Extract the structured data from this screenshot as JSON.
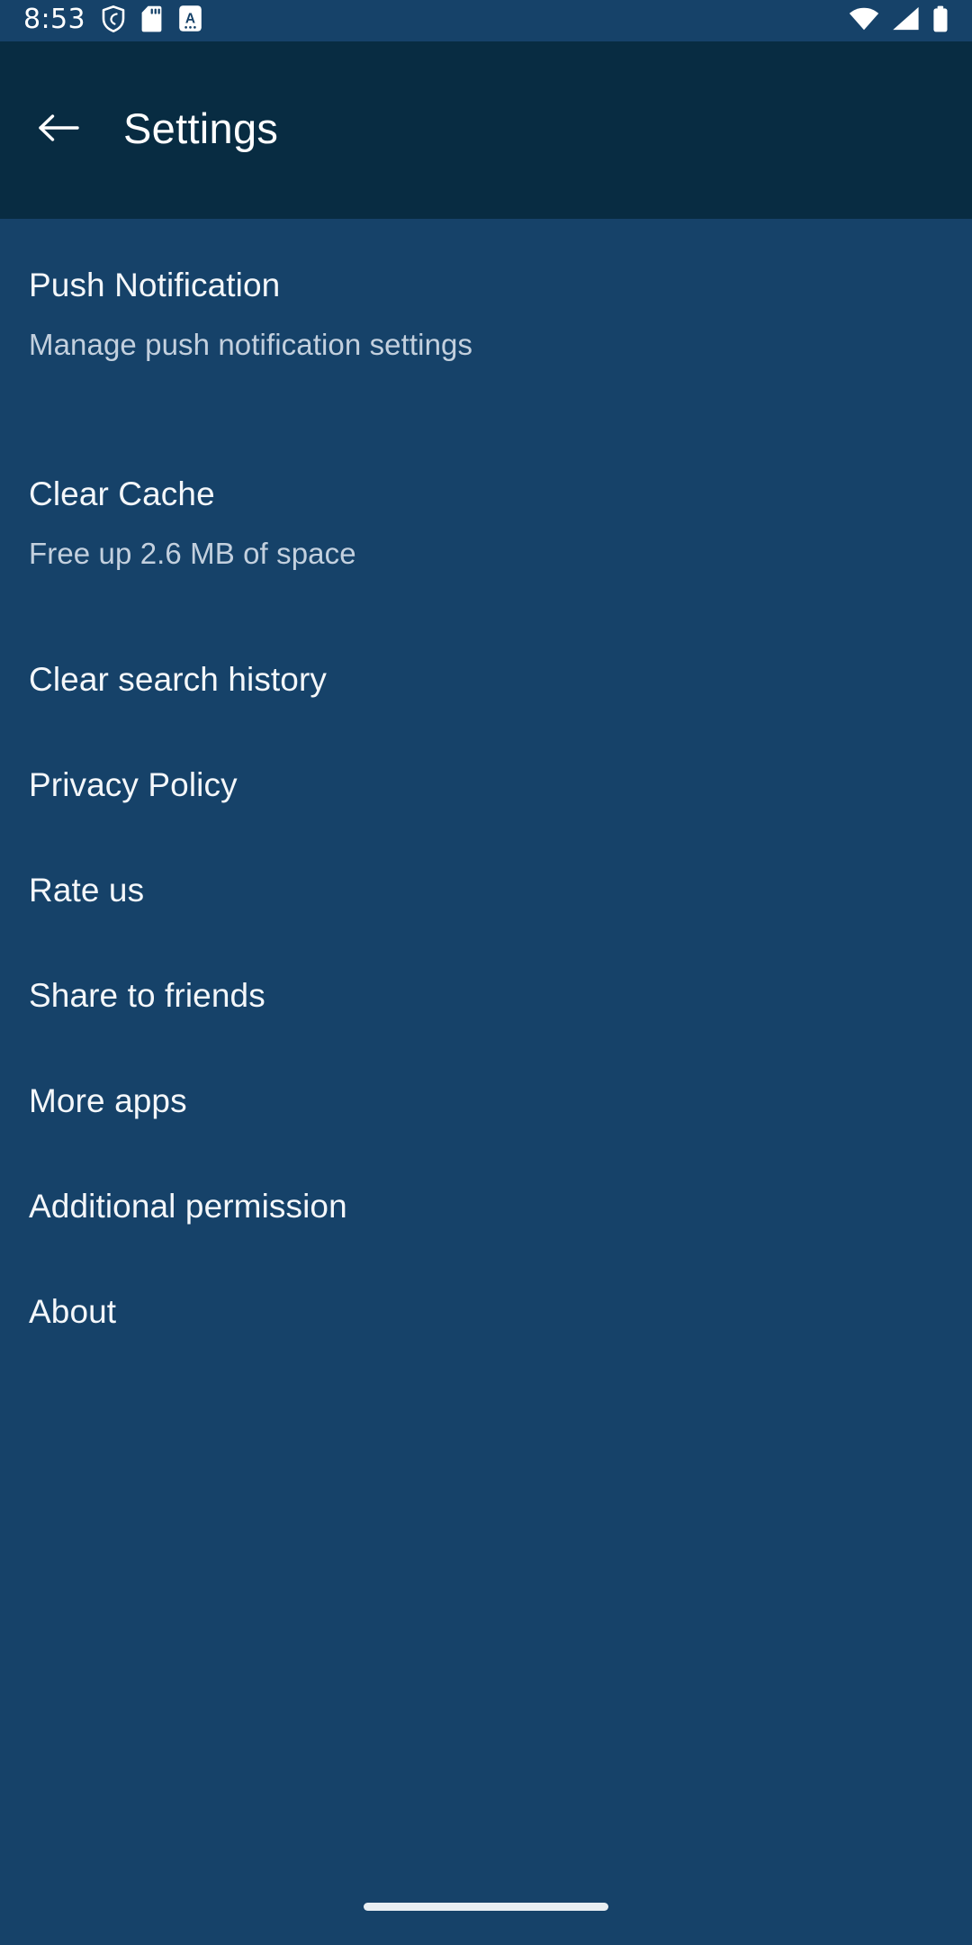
{
  "status_bar": {
    "time": "8:53",
    "left_icons": [
      "shield-icon",
      "sd-card-icon",
      "keyboard-language-icon"
    ],
    "right_icons": [
      "wifi-icon",
      "cellular-signal-icon",
      "battery-icon"
    ],
    "background_color": "#164269",
    "icon_color": "#ffffff"
  },
  "app_bar": {
    "back_icon": "arrow-left-icon",
    "title": "Settings",
    "background_color": "#082c42",
    "title_color": "#ffffff"
  },
  "settings_list": {
    "background_color": "#164269",
    "title_color": "#f4f7fa",
    "subtitle_color": "#c3d0de",
    "items": [
      {
        "title": "Push Notification",
        "subtitle": "Manage push notification settings"
      },
      {
        "title": "Clear Cache",
        "subtitle": "Free up 2.6 MB of space"
      },
      {
        "title": "Clear search history",
        "subtitle": ""
      },
      {
        "title": "Privacy Policy",
        "subtitle": ""
      },
      {
        "title": "Rate us",
        "subtitle": ""
      },
      {
        "title": "Share to friends",
        "subtitle": ""
      },
      {
        "title": "More apps",
        "subtitle": ""
      },
      {
        "title": "Additional permission",
        "subtitle": ""
      },
      {
        "title": "About",
        "subtitle": ""
      }
    ]
  },
  "nav_bar": {
    "handle_icon": "gesture-home-handle",
    "handle_color": "#e8eef3"
  }
}
